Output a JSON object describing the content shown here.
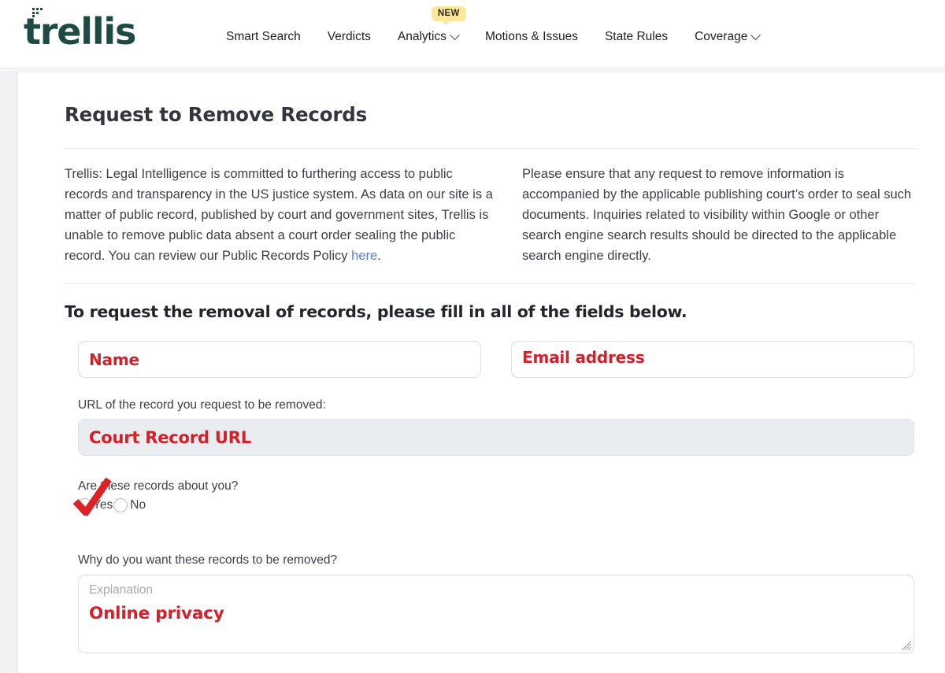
{
  "brand": {
    "logo_text": "trellis"
  },
  "nav": {
    "items": [
      {
        "label": "Smart Search",
        "has_chevron": false,
        "badge": null
      },
      {
        "label": "Verdicts",
        "has_chevron": false,
        "badge": null
      },
      {
        "label": "Analytics",
        "has_chevron": true,
        "badge": "NEW"
      },
      {
        "label": "Motions & Issues",
        "has_chevron": false,
        "badge": null
      },
      {
        "label": "State Rules",
        "has_chevron": false,
        "badge": null
      },
      {
        "label": "Coverage",
        "has_chevron": true,
        "badge": null
      }
    ]
  },
  "main": {
    "title": "Request to Remove Records",
    "intro_left_part1": "Trellis: Legal Intelligence is committed to furthering access to public records and transparency in the US justice system. As data on our site is a matter of public record, published by court and government sites, Trellis is unable to remove public data absent a court order sealing the public record. You can review our Public Records Policy ",
    "intro_left_link": "here",
    "intro_left_part2": ".",
    "intro_right": "Please ensure that any request to remove information is accompanied by the applicable publishing court’s order to seal such documents. Inquiries related to visibility within Google or other search engine search results should be directed to the applicable search engine directly.",
    "instruction": "To request the removal of records, please fill in all of the fields below."
  },
  "form": {
    "name_value": "Name",
    "name_placeholder": "Name",
    "email_value": "Email address",
    "email_placeholder": "Email address",
    "url_label": "URL of the record you request to be removed:",
    "url_value": "Court Record URL",
    "url_placeholder": "Court Record URL",
    "radio_question": "Are these records about you?",
    "radio_yes": "Yes",
    "radio_no": "No",
    "radio_selected": "Yes",
    "textarea_label": "Why do you want these records to be removed?",
    "textarea_placeholder": "Explanation",
    "textarea_value": "Online privacy"
  },
  "colors": {
    "brand_green": "#1d4b43",
    "value_red": "#d32029",
    "link_blue": "#5182d0",
    "badge_yellow": "#fce79a",
    "check_red": "#e02027"
  }
}
